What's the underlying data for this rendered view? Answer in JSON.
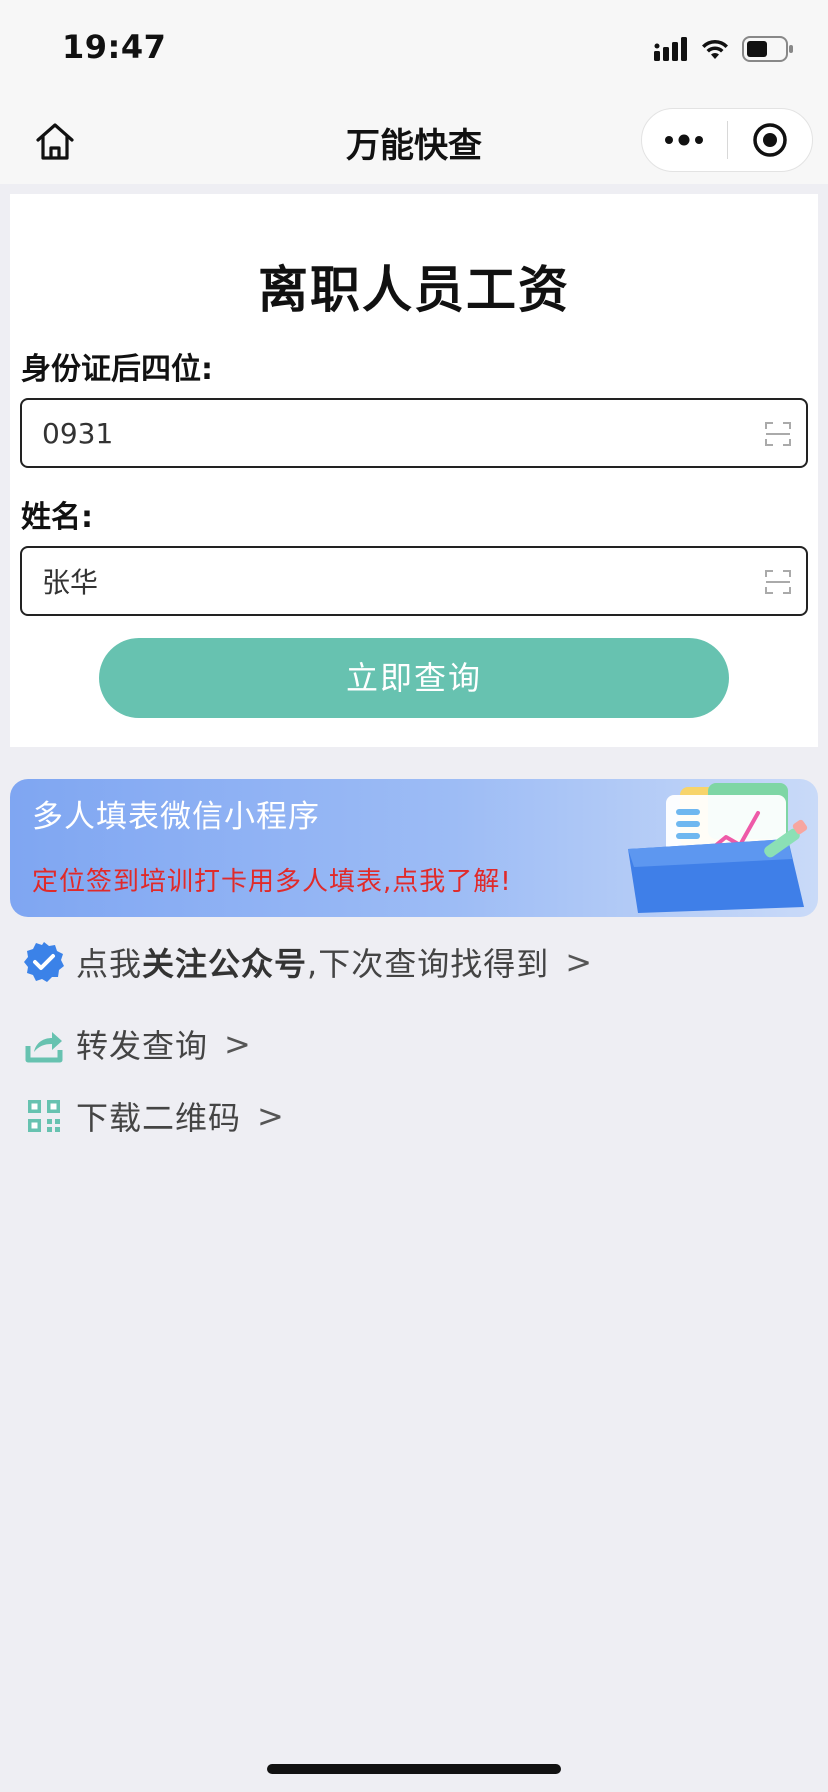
{
  "status_bar": {
    "time": "19:47",
    "icons": [
      "signal-icon",
      "wifi-icon",
      "battery-icon"
    ]
  },
  "nav": {
    "title": "万能快查",
    "home_icon": "home-icon",
    "more_icon": "more-dots-icon",
    "close_icon": "target-close-icon"
  },
  "form": {
    "title": "离职人员工资",
    "id_label": "身份证后四位:",
    "id_value": "0931",
    "name_label": "姓名:",
    "name_value": "张华",
    "submit_label": "立即查询"
  },
  "banner": {
    "title": "多人填表微信小程序",
    "subtitle": "定位签到培训打卡用多人填表,点我了解!"
  },
  "links": {
    "follow_prefix": "点我",
    "follow_strong": "关注公众号",
    "follow_suffix": ",下次查询找得到",
    "forward": "转发查询",
    "download_qr": "下载二维码",
    "arrow": ">"
  },
  "colors": {
    "accent": "#67c2b0",
    "banner_red": "#e02a2a",
    "badge_blue": "#3b82e8",
    "page_bg": "#eeeef3"
  }
}
